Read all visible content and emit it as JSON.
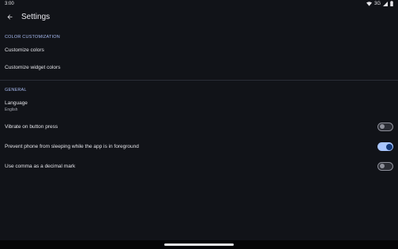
{
  "status_bar": {
    "time": "3:00",
    "network": "3G",
    "icons": [
      "wifi-icon",
      "signal-icon",
      "battery-icon"
    ]
  },
  "app_bar": {
    "title": "Settings",
    "back_icon": "arrow-back-icon"
  },
  "sections": {
    "color": {
      "header": "COLOR CUSTOMIZATION",
      "items": [
        "Customize colors",
        "Customize widget colors"
      ]
    },
    "general": {
      "header": "GENERAL",
      "language": {
        "title": "Language",
        "value": "English"
      },
      "toggles": [
        {
          "label": "Vibrate on button press",
          "checked": false
        },
        {
          "label": "Prevent phone from sleeping while the app is in foreground",
          "checked": true
        },
        {
          "label": "Use comma as a decimal mark",
          "checked": false
        }
      ]
    }
  },
  "colors": {
    "background": "#111318",
    "accent": "#a9c6ff",
    "section_header": "#a9bcf3"
  }
}
